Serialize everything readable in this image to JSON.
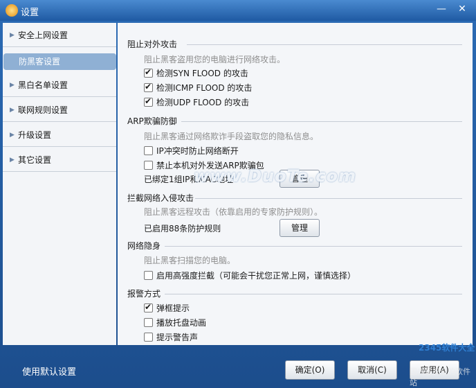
{
  "window": {
    "title": "设置",
    "minimize": "—",
    "close": "✕"
  },
  "sidebar": {
    "items": [
      {
        "label": "安全上网设置",
        "selected": false
      },
      {
        "label": "防黑客设置",
        "selected": true
      },
      {
        "label": "黑白名单设置",
        "selected": false
      },
      {
        "label": "联网规则设置",
        "selected": false
      },
      {
        "label": "升级设置",
        "selected": false
      },
      {
        "label": "其它设置",
        "selected": false
      }
    ]
  },
  "sections": {
    "attack": {
      "title": "阻止对外攻击",
      "hint": "阻止黑客盗用您的电脑进行网络攻击。",
      "options": [
        {
          "label": "检测SYN FLOOD 的攻击",
          "checked": true
        },
        {
          "label": "检测ICMP FLOOD 的攻击",
          "checked": true
        },
        {
          "label": "检测UDP FLOOD 的攻击",
          "checked": true
        }
      ]
    },
    "arp": {
      "title": "ARP欺骗防御",
      "hint": "阻止黑客通过网络欺诈手段盗取您的隐私信息。",
      "options": [
        {
          "label": "IP冲突时防止网络断开",
          "checked": false
        },
        {
          "label": "禁止本机对外发送ARP欺骗包",
          "checked": false
        }
      ],
      "bound_text": "已绑定1组IP和MAC地址",
      "manage_label": "管理"
    },
    "intrusion": {
      "title": "拦截网络入侵攻击",
      "hint": "阻止黑客远程攻击（依靠启用的专家防护规则）。",
      "rules_text": "已启用88条防护规则",
      "manage_label": "管理"
    },
    "stealth": {
      "title": "网络隐身",
      "hint": "阻止黑客扫描您的电脑。",
      "option": {
        "label": "启用高强度拦截（可能会干扰您正常上网，谨慎选择）",
        "checked": false
      }
    },
    "alarm": {
      "title": "报警方式",
      "options": [
        {
          "label": "弹框提示",
          "checked": true
        },
        {
          "label": "播放托盘动画",
          "checked": false
        },
        {
          "label": "提示警告声",
          "checked": false
        }
      ]
    }
  },
  "footer": {
    "default_link": "使用默认设置",
    "ok_label": "确定(O)",
    "cancel_label": "取消(C)",
    "apply_label": "应用(A)"
  },
  "watermarks": {
    "main": "www.DuoTe.com",
    "corner_top": "2345软件大全",
    "corner_bottom": "国内最安全的软件站"
  }
}
